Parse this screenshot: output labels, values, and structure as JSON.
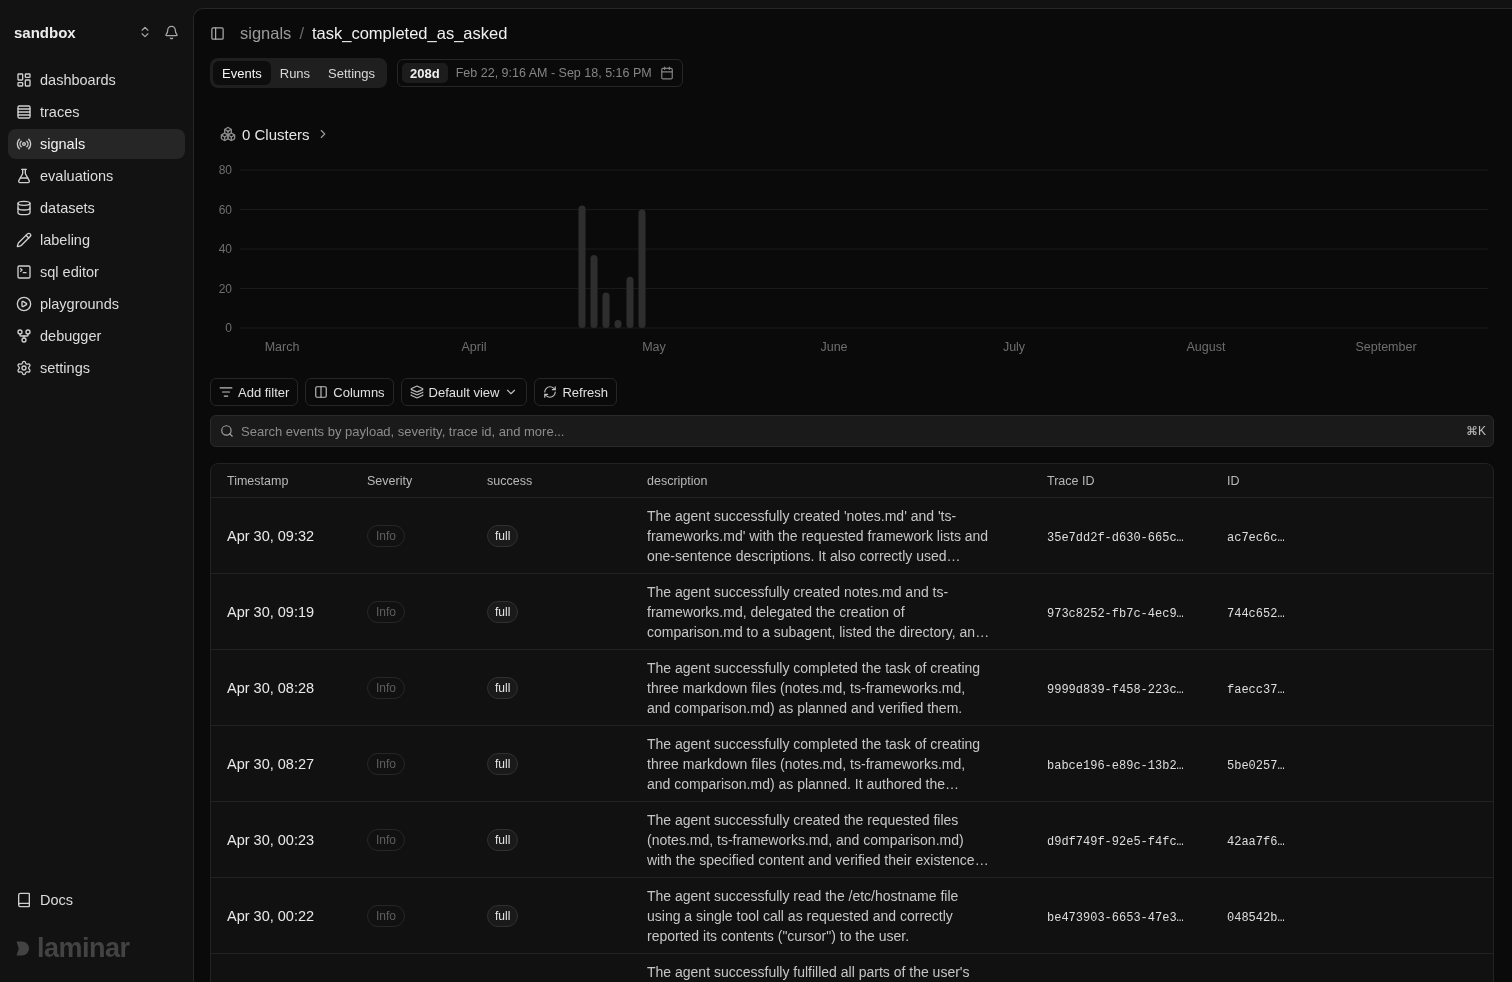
{
  "sidebar": {
    "workspace": "sandbox",
    "items": [
      {
        "label": "dashboards",
        "selected": false
      },
      {
        "label": "traces",
        "selected": false
      },
      {
        "label": "signals",
        "selected": true
      },
      {
        "label": "evaluations",
        "selected": false
      },
      {
        "label": "datasets",
        "selected": false
      },
      {
        "label": "labeling",
        "selected": false
      },
      {
        "label": "sql editor",
        "selected": false
      },
      {
        "label": "playgrounds",
        "selected": false
      },
      {
        "label": "debugger",
        "selected": false
      },
      {
        "label": "settings",
        "selected": false
      }
    ],
    "docs_link": "Docs",
    "logo": "laminar"
  },
  "breadcrumb": {
    "parent": "signals",
    "separator": "/",
    "current": "task_completed_as_asked"
  },
  "tabs": [
    {
      "label": "Events",
      "selected": true
    },
    {
      "label": "Runs",
      "selected": false
    },
    {
      "label": "Settings",
      "selected": false
    }
  ],
  "date_range": {
    "preset": "208d",
    "range": "Feb 22, 9:16 AM - Sep 18, 5:16 PM"
  },
  "clusters": {
    "label": "0 Clusters"
  },
  "chart": {
    "chart_data": {
      "type": "bar",
      "grid": true,
      "categories": [
        null,
        null,
        null,
        "March",
        null,
        null,
        null,
        null,
        null,
        null,
        null,
        null,
        null,
        null,
        null,
        null,
        null,
        null,
        null,
        "April",
        null,
        null,
        null,
        null,
        null,
        null,
        null,
        null,
        null,
        null,
        null,
        null,
        null,
        null,
        "May",
        null,
        null,
        null,
        null,
        null,
        null,
        null,
        null,
        null,
        null,
        null,
        null,
        null,
        null,
        "June",
        null,
        null,
        null,
        null,
        null,
        null,
        null,
        null,
        null,
        null,
        null,
        null,
        null,
        null,
        "July",
        null,
        null,
        null,
        null,
        null,
        null,
        null,
        null,
        null,
        null,
        null,
        null,
        null,
        null,
        null,
        "August",
        null,
        null,
        null,
        null,
        null,
        null,
        null,
        null,
        null,
        null,
        null,
        null,
        null,
        null,
        "September",
        null,
        null,
        null,
        null,
        null,
        null,
        null,
        null
      ],
      "values": [
        null,
        null,
        null,
        null,
        null,
        null,
        null,
        null,
        null,
        null,
        null,
        null,
        null,
        null,
        null,
        null,
        null,
        null,
        null,
        null,
        null,
        null,
        null,
        null,
        null,
        null,
        null,
        null,
        62,
        37,
        18,
        4,
        26,
        60,
        null,
        null,
        null,
        null,
        null,
        null,
        null,
        null,
        null,
        null,
        null,
        null,
        null,
        null,
        null,
        null,
        null,
        null,
        null,
        null,
        null,
        null,
        null,
        null,
        null,
        null,
        null,
        null,
        null,
        null,
        null,
        null,
        null,
        null,
        null,
        null,
        null,
        null,
        null,
        null,
        null,
        null,
        null,
        null,
        null,
        null,
        null,
        null,
        null,
        null,
        null,
        null,
        null,
        null,
        null,
        null,
        null,
        null,
        null,
        null,
        null,
        null,
        null,
        null,
        null,
        null,
        null,
        null,
        null,
        null
      ],
      "ylim": [
        0,
        80
      ],
      "yticks": [
        0,
        20,
        40,
        60,
        80
      ]
    }
  },
  "toolbar": {
    "buttons": [
      {
        "label": "Add filter",
        "menu": false
      },
      {
        "label": "Columns",
        "menu": false
      },
      {
        "label": "Default view",
        "menu": true
      },
      {
        "label": "Refresh",
        "menu": false
      }
    ]
  },
  "search": {
    "placeholder": "Search events by payload, severity, trace id, and more...",
    "shortcut": "⌘K"
  },
  "table": {
    "columns": [
      "Timestamp",
      "Severity",
      "success",
      "description",
      "Trace ID",
      "ID"
    ],
    "rows": [
      {
        "timestamp": "Apr 30, 09:32",
        "severity": "Info",
        "success": "full",
        "description": "The agent successfully created 'notes.md' and 'ts-frameworks.md' with the requested framework lists and one-sentence descriptions. It also correctly used…",
        "trace_id": "35e7dd2f-d630-665c…",
        "id": "ac7ec6c…"
      },
      {
        "timestamp": "Apr 30, 09:19",
        "severity": "Info",
        "success": "full",
        "description": "The agent successfully created notes.md and ts-frameworks.md, delegated the creation of comparison.md to a subagent, listed the directory, an…",
        "trace_id": "973c8252-fb7c-4ec9…",
        "id": "744c652…"
      },
      {
        "timestamp": "Apr 30, 08:28",
        "severity": "Info",
        "success": "full",
        "description": "The agent successfully completed the task of creating three markdown files (notes.md, ts-frameworks.md, and comparison.md) as planned and verified them.",
        "trace_id": "9999d839-f458-223c…",
        "id": "faecc37…"
      },
      {
        "timestamp": "Apr 30, 08:27",
        "severity": "Info",
        "success": "full",
        "description": "The agent successfully completed the task of creating three markdown files (notes.md, ts-frameworks.md, and comparison.md) as planned. It authored the…",
        "trace_id": "babce196-e89c-13b2…",
        "id": "5be0257…"
      },
      {
        "timestamp": "Apr 30, 00:23",
        "severity": "Info",
        "success": "full",
        "description": "The agent successfully created the requested files (notes.md, ts-frameworks.md, and comparison.md) with the specified content and verified their existence…",
        "trace_id": "d9df749f-92e5-f4fc…",
        "id": "42aa7f6…"
      },
      {
        "timestamp": "Apr 30, 00:22",
        "severity": "Info",
        "success": "full",
        "description": "The agent successfully read the /etc/hostname file using a single tool call as requested and correctly reported its contents (\"cursor\") to the user.",
        "trace_id": "be473903-6653-47e3…",
        "id": "048542b…"
      },
      {
        "description": "The agent successfully fulfilled all parts of the user's"
      }
    ]
  }
}
